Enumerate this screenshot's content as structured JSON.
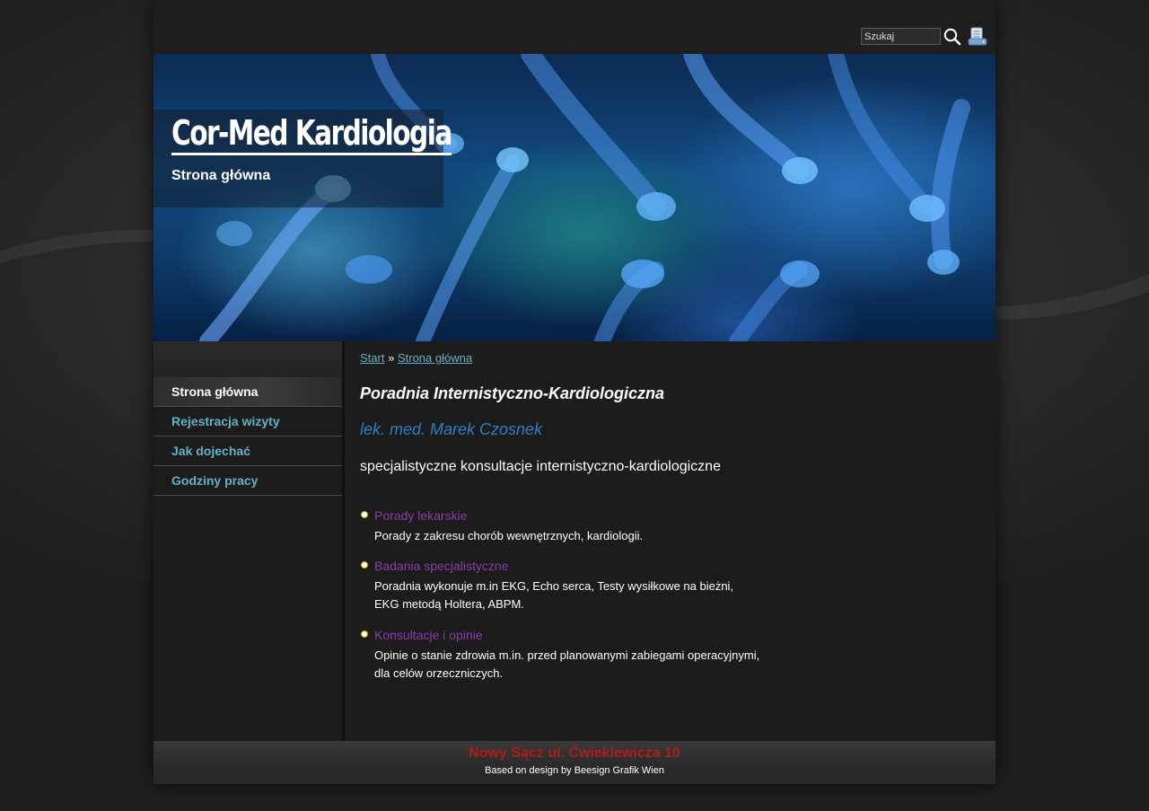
{
  "header": {
    "search_placeholder": "Szukaj",
    "search_icon": "search-icon",
    "print_icon": "print-icon"
  },
  "banner": {
    "site_title": "Cor-Med Kardiologia",
    "site_subtitle": "Strona główna"
  },
  "sidebar": {
    "items": [
      {
        "label": "Strona główna",
        "active": true
      },
      {
        "label": "Rejestracja wizyty",
        "active": false
      },
      {
        "label": "Jak dojechać",
        "active": false
      },
      {
        "label": "Godziny pracy",
        "active": false
      }
    ]
  },
  "breadcrumb": {
    "start": "Start",
    "separator": "»",
    "current": "Strona główna"
  },
  "main": {
    "heading": "Poradnia Internistyczno-Kardiologiczna",
    "doctor": "lek. med. Marek Czosnek",
    "intro": "specjalistyczne konsultacje internistyczno-kardiologiczne",
    "services": [
      {
        "title": "Porady lekarskie",
        "desc1": "Porady z zakresu chorób wewnętrznych, kardiologii.",
        "desc2": ""
      },
      {
        "title": "Badania specjalistyczne",
        "desc1": "Poradnia wykonuje m.in EKG, Echo serca, Testy wysiłkowe na bieżni,",
        "desc2": "EKG metodą Holtera, ABPM."
      },
      {
        "title": "Konsultacje i opinie",
        "desc1": "Opinie o stanie zdrowia m.in. przed planowanymi zabiegami operacyjnymi,",
        "desc2": "dla celów orzeczniczych."
      }
    ]
  },
  "footer": {
    "address": "Nowy Sącz ul. Ćwieklewicza 10",
    "credit": "Based on design by Beesign Grafik Wien"
  },
  "colors": {
    "link": "#63b1c6",
    "doctor": "#2f7fc4",
    "service_title": "#8a3ca8",
    "address": "#b01b1b"
  }
}
